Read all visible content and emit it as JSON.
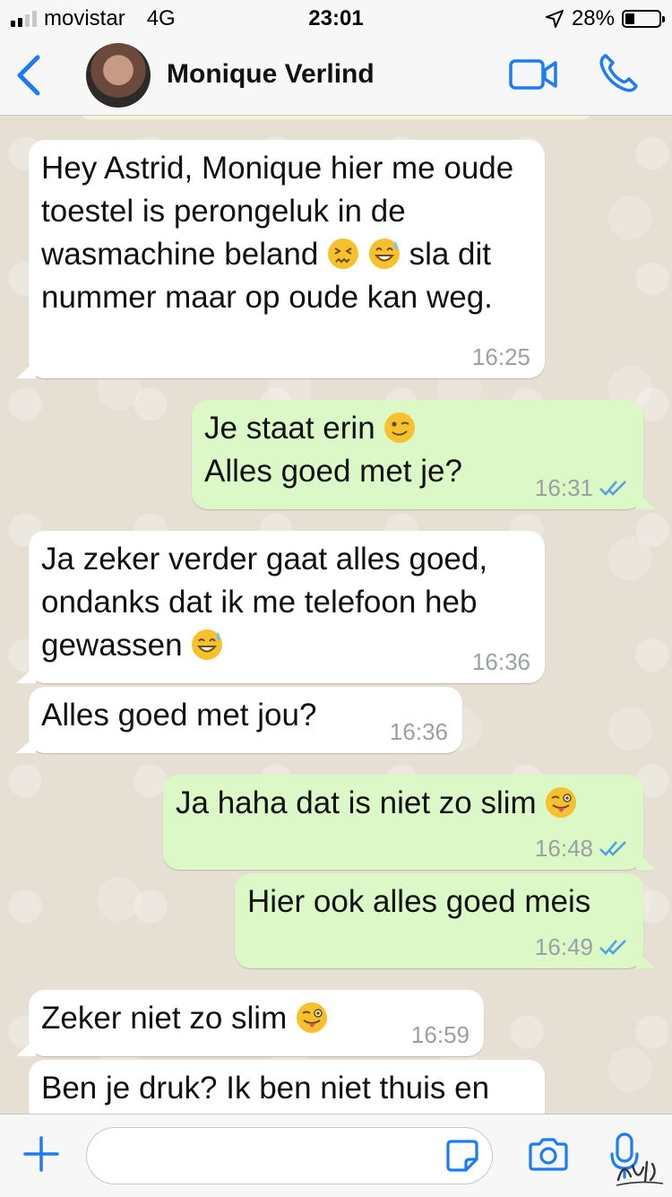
{
  "status_bar": {
    "carrier": "movistar",
    "network": "4G",
    "time": "23:01",
    "battery": "28%",
    "battery_level": 0.28
  },
  "header": {
    "contact_name": "Monique Verlind",
    "icons": [
      "back-chevron-icon",
      "video-call-icon",
      "phone-call-icon"
    ],
    "accent_color": "#1a7cf6"
  },
  "messages": [
    {
      "direction": "in",
      "text": "Hey Astrid, Monique hier me oude toestel is perongeluk in de wasmachine beland",
      "text_after": "sla dit nummer maar op oude kan weg.",
      "emojis": [
        "confounded-face",
        "sweat-smile-face"
      ],
      "time": "16:25"
    },
    {
      "direction": "out",
      "text": "Je staat erin",
      "text_after": "Alles goed met je?",
      "emojis": [
        "wink-face"
      ],
      "time": "16:31",
      "read": true
    },
    {
      "direction": "in",
      "text": "Ja zeker verder gaat alles goed, ondanks dat ik me telefoon heb gewassen",
      "emojis": [
        "sweat-smile-face"
      ],
      "time": "16:36"
    },
    {
      "direction": "in",
      "text": "Alles goed met jou?",
      "time": "16:36"
    },
    {
      "direction": "out",
      "text": "Ja haha dat is niet zo slim",
      "emojis": [
        "winking-tongue-face"
      ],
      "time": "16:48",
      "read": true
    },
    {
      "direction": "out",
      "text": "Hier ook alles goed meis",
      "time": "16:49",
      "read": true
    },
    {
      "direction": "in",
      "text": "Zeker niet zo slim",
      "emojis": [
        "winking-tongue-face"
      ],
      "time": "16:59"
    },
    {
      "direction": "in",
      "text": "Ben je druk? Ik ben niet thuis en",
      "time": ""
    }
  ],
  "colors": {
    "incoming_bubble": "#ffffff",
    "outgoing_bubble": "#dcf8c6",
    "read_ticks": "#4fa3e0",
    "chat_background": "#e6dfd4"
  },
  "input_bar": {
    "placeholder": "",
    "icons": [
      "plus-icon",
      "sticker-icon",
      "camera-icon",
      "microphone-icon"
    ]
  }
}
